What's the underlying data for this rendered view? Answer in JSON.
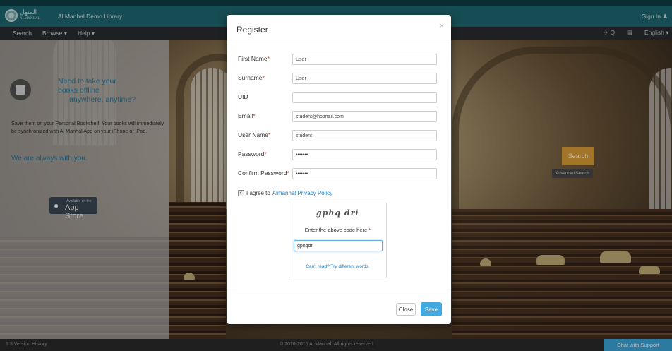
{
  "header": {
    "site_title": "Al Manhal Demo Library",
    "sign_in": "Sign In ♟",
    "logo_text": "المنهل",
    "logo_sub": "ALMANHAL"
  },
  "nav": {
    "items": [
      "Search",
      "Browse ▾",
      "Help ▾"
    ],
    "right_items": [
      "✈ Q",
      "▤",
      "English ▾"
    ]
  },
  "promo": {
    "heading_lines": [
      "Need to take your",
      "books offline",
      "anywhere, anytime?"
    ],
    "body": "Save them on your Personal Bookshelf! Your books will immediately be synchronized with Al Manhal App on your iPhone or iPad.",
    "tagline": "We are always with you.",
    "appstore_small": "Available on the",
    "appstore_big": "App Store",
    "apple_icon": ""
  },
  "search": {
    "button": "Search",
    "advanced": "Advanced Search"
  },
  "footer": {
    "left": "1.3   Version History",
    "copyright": "© 2010-2016 Al Manhal. All rights reserved.",
    "chat": "Chat with Support"
  },
  "modal": {
    "title": "Register",
    "close_glyph": "×",
    "fields": [
      {
        "label": "First Name",
        "required": true,
        "value": "User",
        "type": "text"
      },
      {
        "label": "Surname",
        "required": true,
        "value": "User",
        "type": "text"
      },
      {
        "label": "UID",
        "required": false,
        "value": "",
        "type": "text"
      },
      {
        "label": "Email",
        "required": true,
        "value": "student@hotmail.com",
        "type": "text"
      },
      {
        "label": "User Name",
        "required": true,
        "value": "student",
        "type": "text"
      },
      {
        "label": "Password",
        "required": true,
        "value": "•••••••",
        "type": "text"
      },
      {
        "label": "Confirm Password",
        "required": true,
        "value": "•••••••",
        "type": "text"
      }
    ],
    "required_mark": "*",
    "agree_text": "I agree to",
    "agree_link": "Almanhal Privacy Policy",
    "agree_checked": true,
    "captcha": {
      "image_text": "gphq dri",
      "prompt": "Enter the above code here:",
      "value": "gphqdri",
      "alt_link": "Can't read? Try different words."
    },
    "buttons": {
      "close": "Close",
      "save": "Save"
    }
  }
}
